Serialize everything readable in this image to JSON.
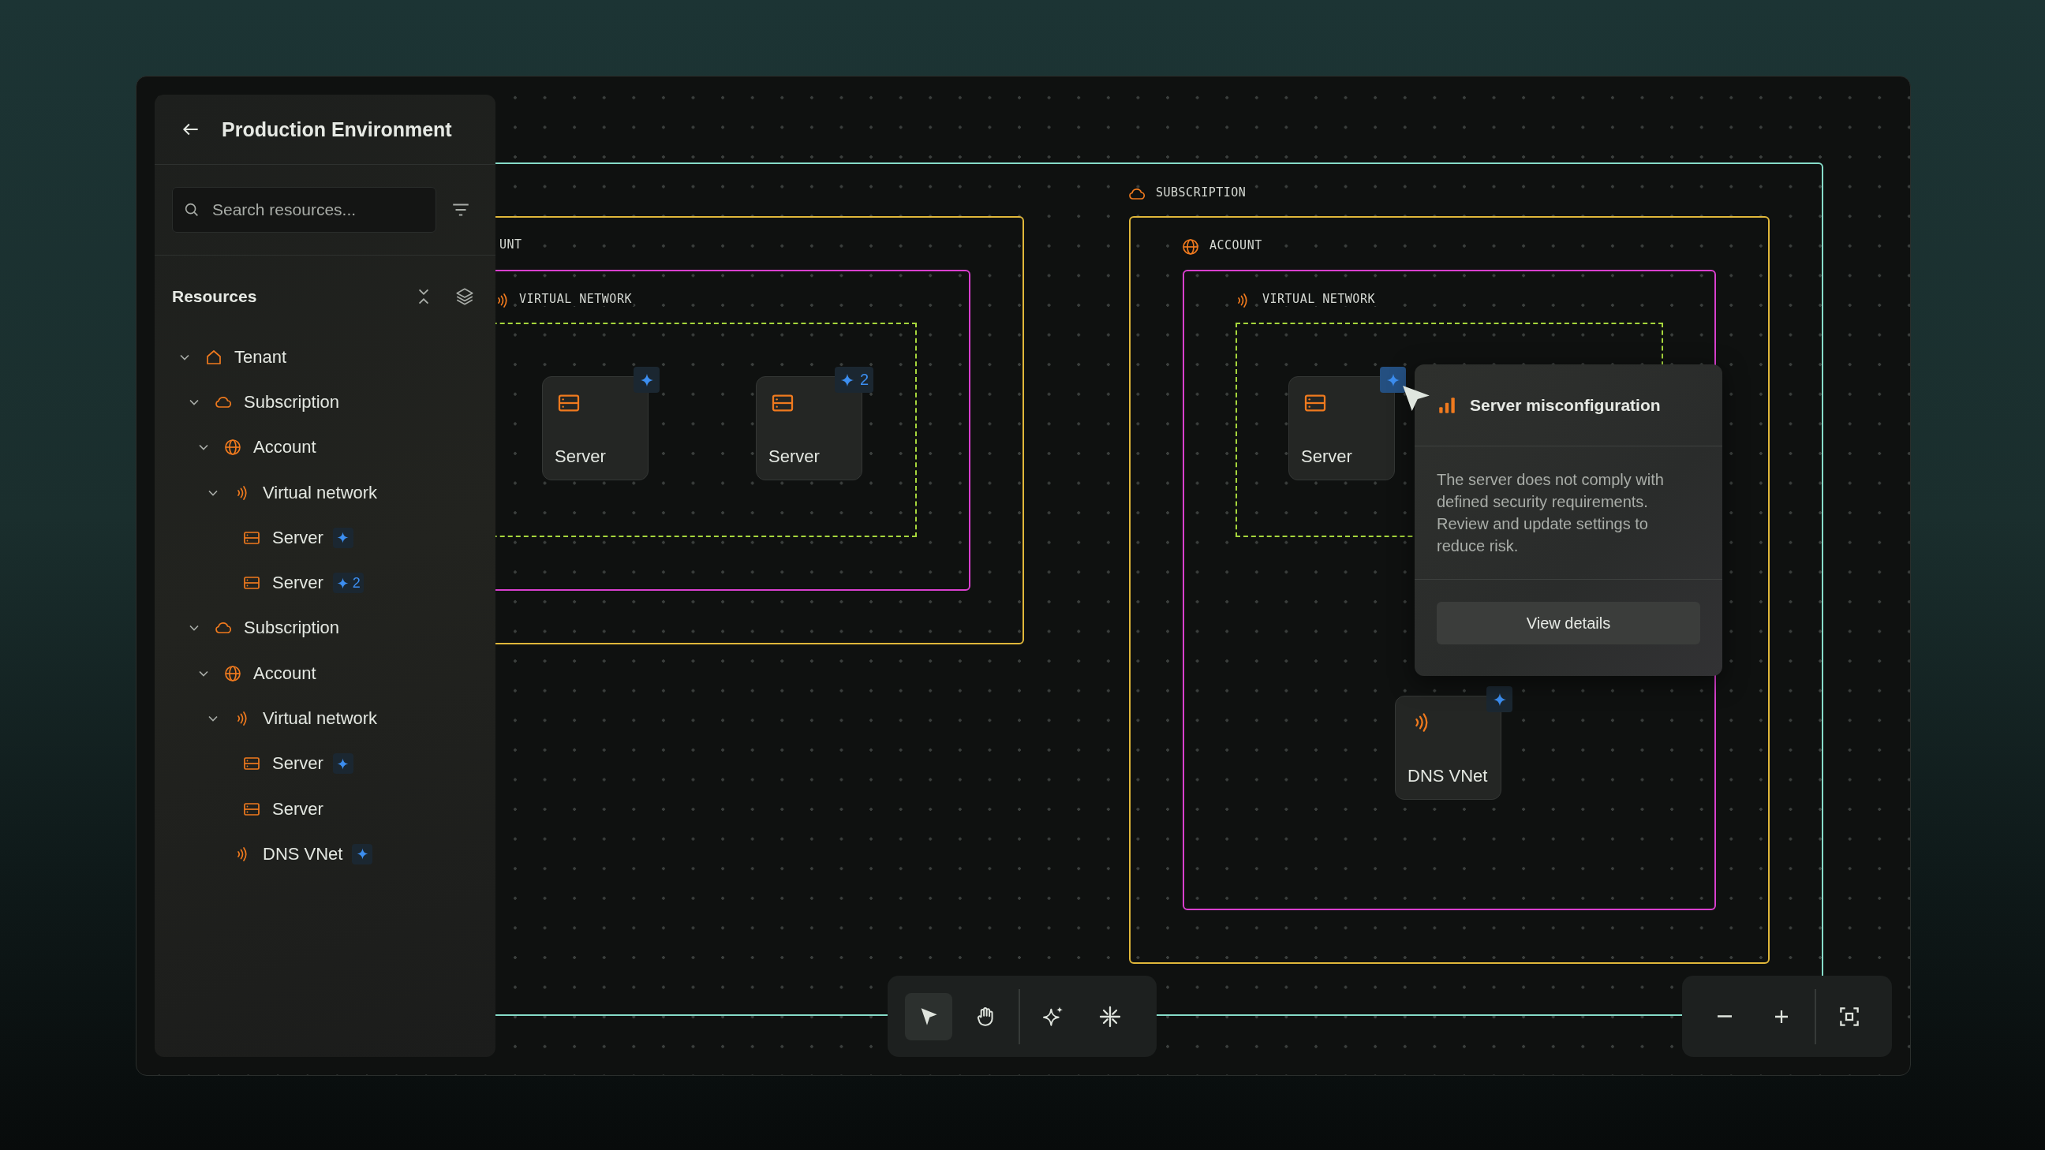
{
  "sidebar": {
    "title": "Production Environment",
    "search": {
      "placeholder": "Search resources..."
    },
    "section_title": "Resources",
    "tree": [
      {
        "kind": "tenant",
        "label": "Tenant",
        "expanded": true,
        "flagged": false,
        "children": [
          {
            "kind": "subscription",
            "label": "Subscription",
            "expanded": true,
            "flagged": false,
            "children": [
              {
                "kind": "account",
                "label": "Account",
                "expanded": true,
                "flagged": false,
                "children": [
                  {
                    "kind": "vnet",
                    "label": "Virtual network",
                    "expanded": true,
                    "flagged": false,
                    "children": [
                      {
                        "kind": "server",
                        "label": "Server",
                        "flagged": true
                      },
                      {
                        "kind": "server",
                        "label": "Server",
                        "flagged": true,
                        "flag_count": "2"
                      }
                    ]
                  }
                ]
              }
            ]
          },
          {
            "kind": "subscription",
            "label": "Subscription",
            "expanded": true,
            "flagged": false,
            "children": [
              {
                "kind": "account",
                "label": "Account",
                "expanded": true,
                "flagged": false,
                "children": [
                  {
                    "kind": "vnet",
                    "label": "Virtual network",
                    "expanded": true,
                    "flagged": false,
                    "children": [
                      {
                        "kind": "server",
                        "label": "Server",
                        "flagged": true
                      },
                      {
                        "kind": "server",
                        "label": "Server",
                        "flagged": false
                      }
                    ]
                  },
                  {
                    "kind": "vnet",
                    "label": "DNS VNet",
                    "flagged": true
                  }
                ]
              }
            ]
          }
        ]
      }
    ]
  },
  "canvas": {
    "left_group": {
      "account_label": "UNT",
      "vnet_label": "VIRTUAL NETWORK",
      "nodes": [
        {
          "kind": "server",
          "label": "Server",
          "flagged": true,
          "selected": false
        },
        {
          "kind": "server",
          "label": "Server",
          "flagged": true,
          "flag_count": "2",
          "selected": false
        }
      ]
    },
    "right_group": {
      "subscription_label": "SUBSCRIPTION",
      "account_label": "ACCOUNT",
      "vnet_label": "VIRTUAL NETWORK",
      "nodes": [
        {
          "kind": "server",
          "label": "Server",
          "flagged": true,
          "selected": true
        },
        {
          "kind": "vnet",
          "label": "DNS VNet",
          "flagged": true,
          "selected": false
        }
      ]
    },
    "tooltip": {
      "title": "Server misconfiguration",
      "body": "The server does not comply with defined security requirements. Review and update settings to reduce risk.",
      "button": "View details"
    }
  },
  "toolbar": {
    "tools": [
      {
        "kind": "select",
        "selected": true
      },
      {
        "kind": "pan",
        "selected": false
      },
      {
        "kind": "sparkles",
        "selected": false
      },
      {
        "kind": "asterisk",
        "selected": false
      }
    ]
  },
  "zoom_controls": [
    {
      "kind": "zoom_out"
    },
    {
      "kind": "zoom_in"
    },
    {
      "kind": "fit"
    }
  ]
}
